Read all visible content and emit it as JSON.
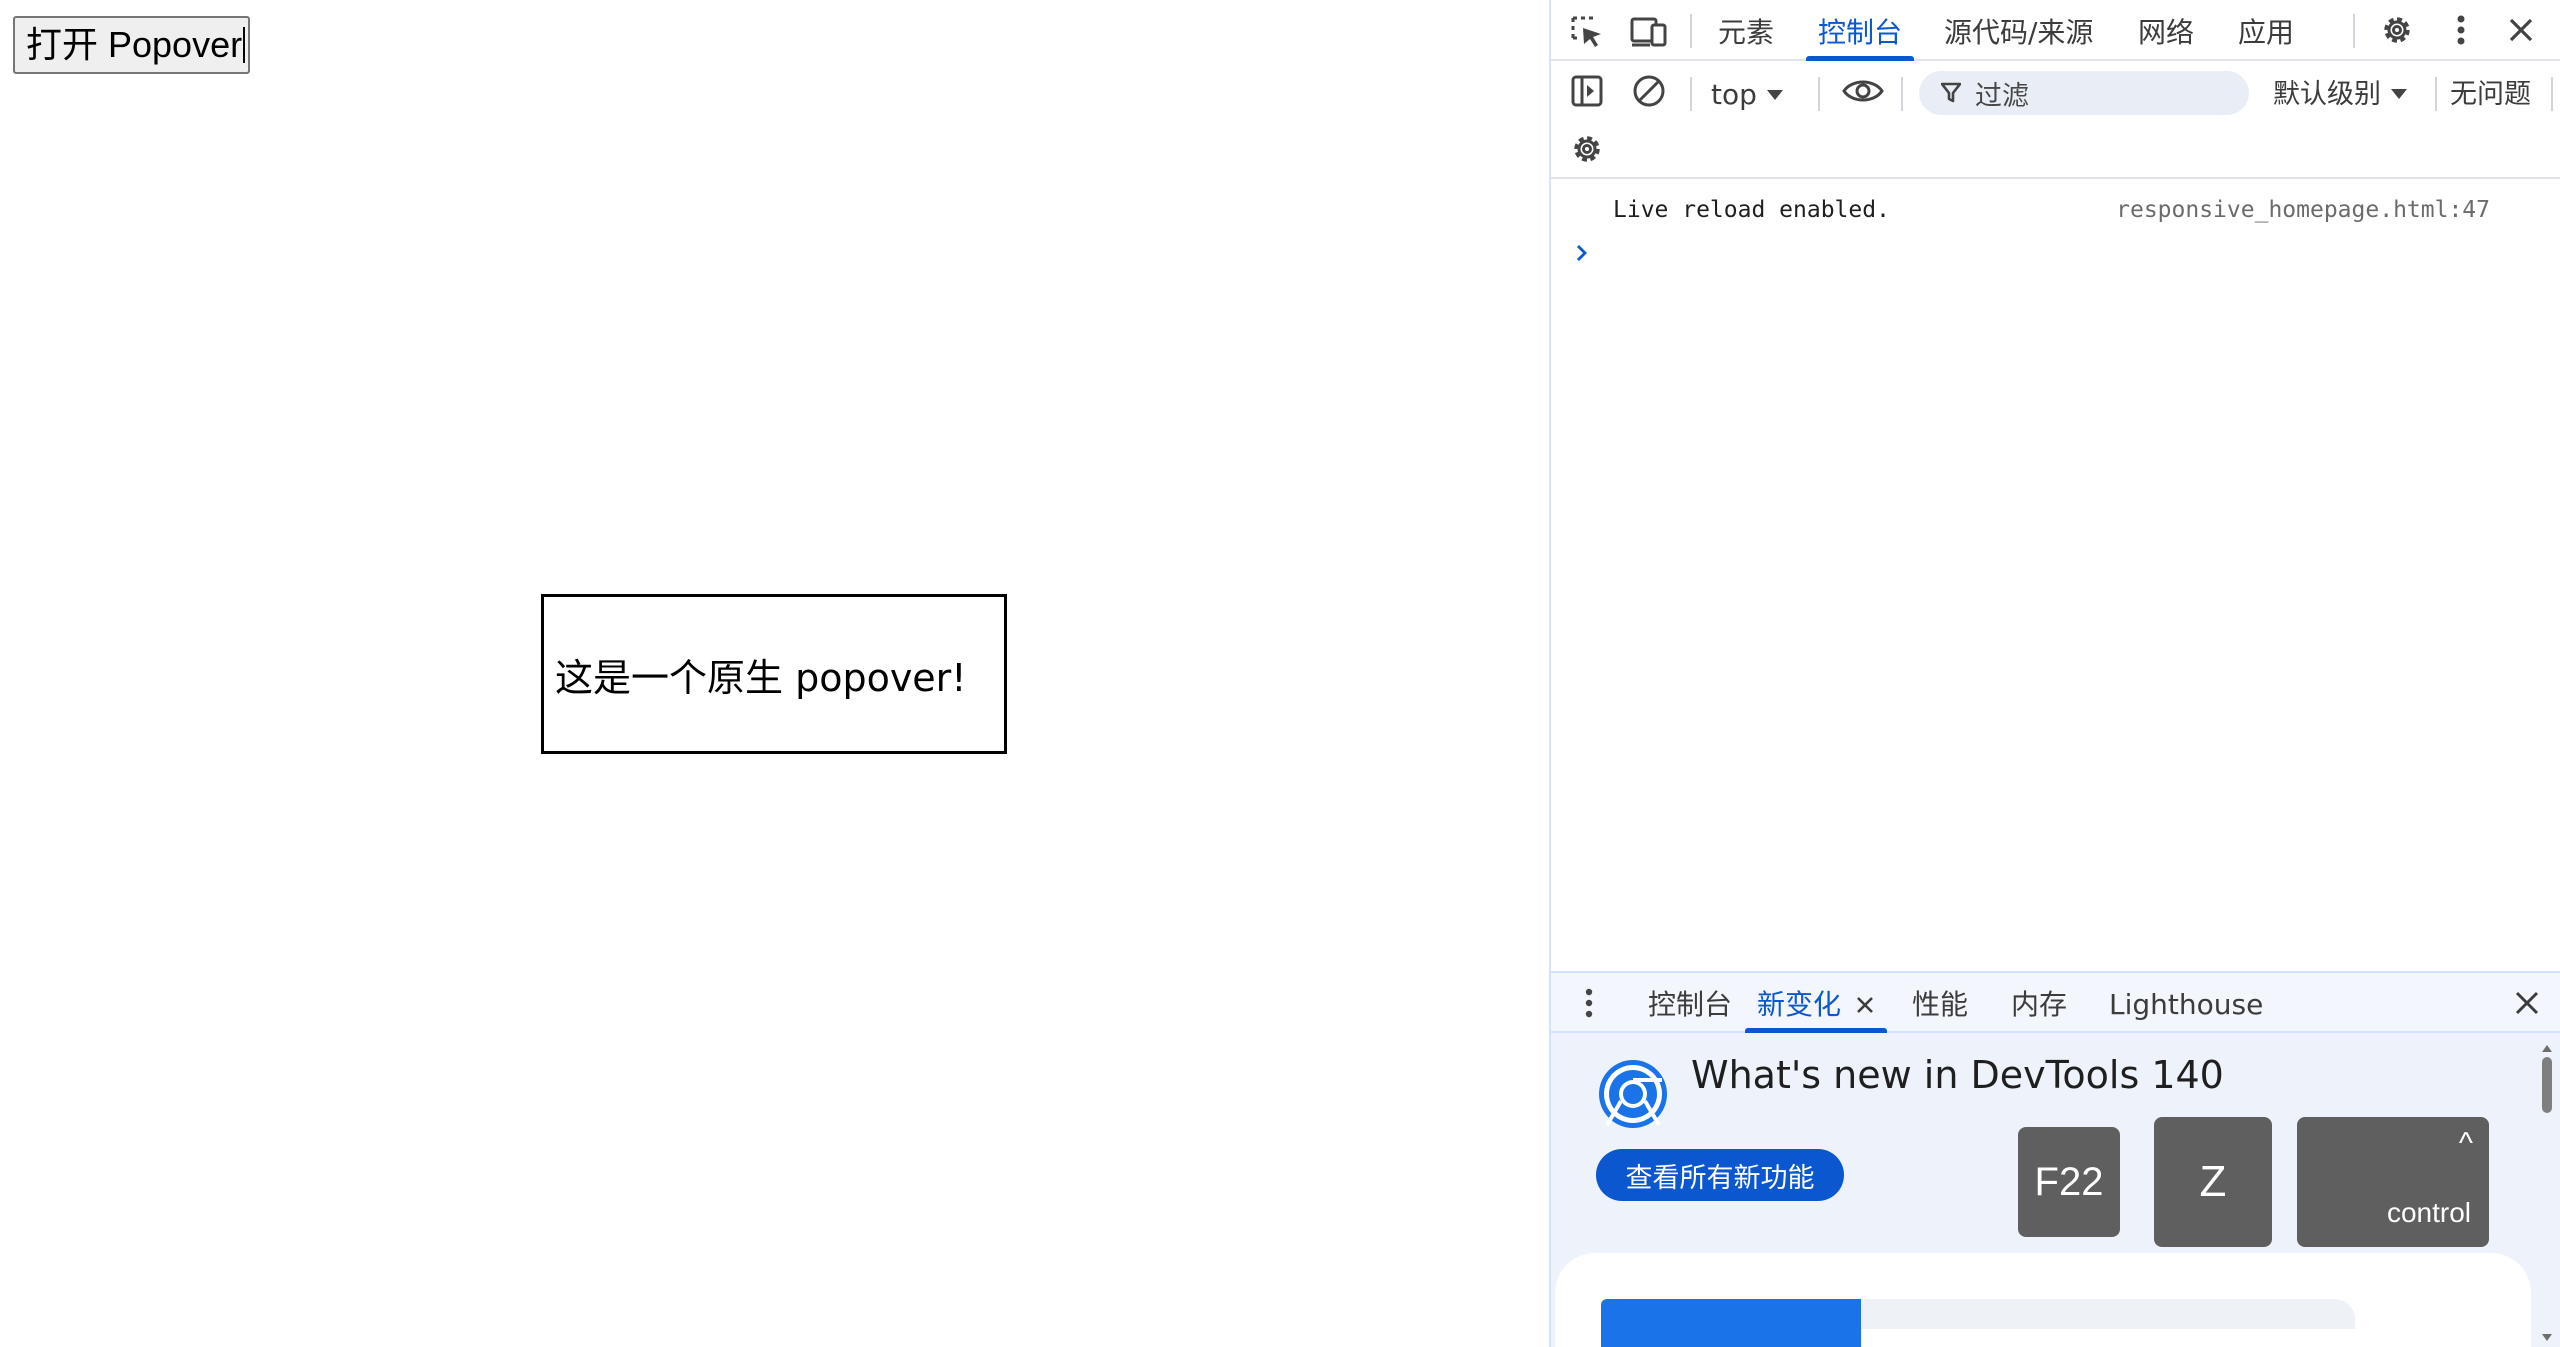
{
  "page": {
    "open_button_label": "打开 Popover",
    "popover_text": "这是一个原生 popover!"
  },
  "devtools": {
    "top_tabs": [
      {
        "label": "元素"
      },
      {
        "label": "控制台"
      },
      {
        "label": "源代码/来源"
      },
      {
        "label": "网络"
      },
      {
        "label": "应用"
      }
    ],
    "active_tab": "控制台",
    "toolbar": {
      "context": "top",
      "filter_placeholder": "过滤",
      "level": "默认级别",
      "issues": "无问题"
    },
    "console": {
      "messages": [
        {
          "text": "Live reload enabled.",
          "source": "responsive_homepage.html:47"
        }
      ]
    },
    "drawer": {
      "tabs": [
        {
          "label": "控制台"
        },
        {
          "label": "新变化"
        },
        {
          "label": "性能"
        },
        {
          "label": "内存"
        },
        {
          "label": "Lighthouse"
        }
      ],
      "active_tab": "新变化",
      "whats_new_title": "What's new in DevTools 140",
      "see_all_button": "查看所有新功能",
      "keys": [
        {
          "label": "F22"
        },
        {
          "label": "Z"
        },
        {
          "label": "control",
          "symbol": "^"
        }
      ]
    },
    "accent_color": "#0b57d0"
  }
}
